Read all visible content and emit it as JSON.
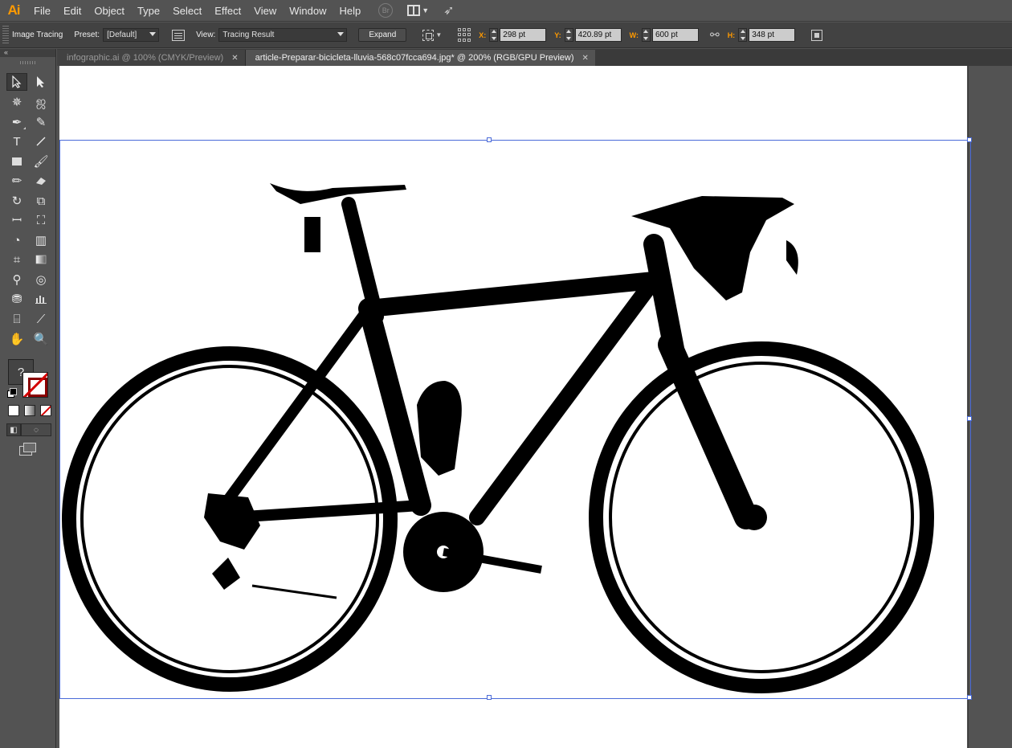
{
  "app": {
    "logo": "Ai"
  },
  "menu": [
    "File",
    "Edit",
    "Object",
    "Type",
    "Select",
    "Effect",
    "View",
    "Window",
    "Help"
  ],
  "menu_extras": {
    "bridge_label": "Br"
  },
  "control_bar": {
    "image_tracing_label": "Image Tracing",
    "preset_label": "Preset:",
    "preset_value": "[Default]",
    "view_label": "View:",
    "view_value": "Tracing Result",
    "expand_label": "Expand",
    "x_label": "X:",
    "x_value": "298 pt",
    "y_label": "Y:",
    "y_value": "420.89 pt",
    "w_label": "W:",
    "w_value": "600 pt",
    "h_label": "H:",
    "h_value": "348 pt"
  },
  "tabs": [
    {
      "label": "infographic.ai @ 100% (CMYK/Preview)",
      "active": false
    },
    {
      "label": "article-Preparar-bicicleta-lluvia-568c07fcca694.jpg* @ 200% (RGB/GPU Preview)",
      "active": true
    }
  ],
  "toolbar": {
    "type_glyph": "T",
    "fill_glyph": "?"
  },
  "colors": {
    "accent": "#ff9a00",
    "selection": "#4a6ad8",
    "stroke_none": "#d40000"
  }
}
